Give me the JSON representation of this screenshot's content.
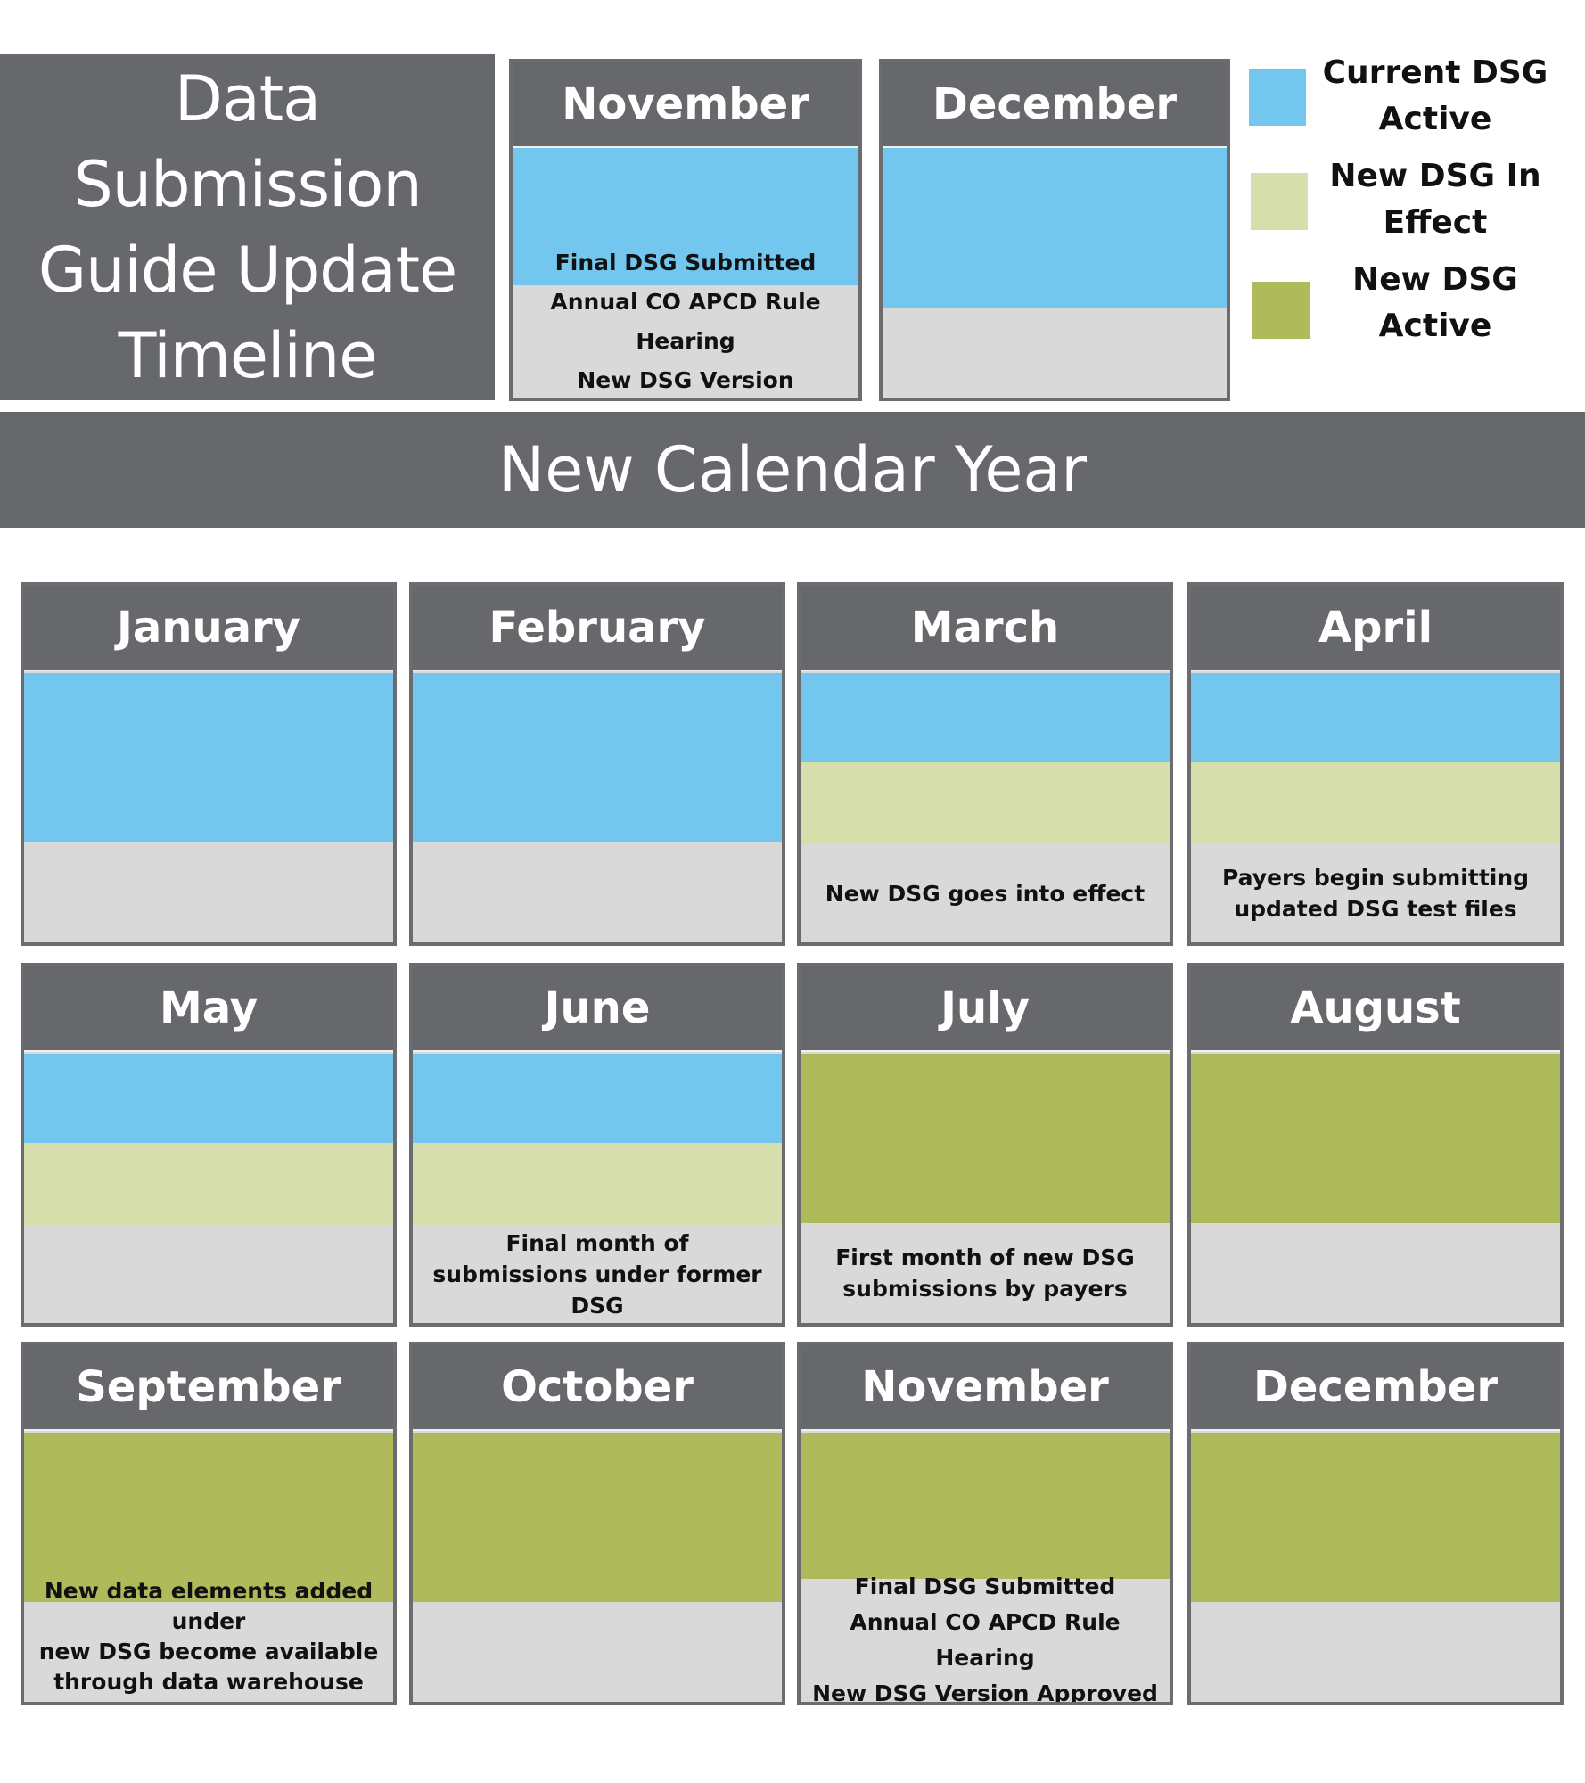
{
  "title": "Data Submission Guide Update Timeline",
  "title_lines": [
    "Data Submission",
    "Guide Update",
    "Timeline"
  ],
  "colors": {
    "header_gray": "#67686c",
    "empty_gray": "#d9d9d9",
    "current_dsg_active": "#73c7ef",
    "new_dsg_in_effect": "#d6dfab",
    "new_dsg_active": "#afbb5a"
  },
  "legend": [
    {
      "key": "current",
      "lines": [
        "Current DSG",
        "Active"
      ]
    },
    {
      "key": "effect",
      "lines": [
        "New DSG In",
        "Effect"
      ]
    },
    {
      "key": "new",
      "lines": [
        "New DSG",
        "Active"
      ]
    }
  ],
  "prior_year": [
    {
      "month": "November",
      "status": [
        "current"
      ],
      "notes": [
        "Final DSG Submitted",
        "Annual CO APCD Rule Hearing",
        "New DSG Version Approved"
      ]
    },
    {
      "month": "December",
      "status": [
        "current"
      ],
      "notes": []
    }
  ],
  "band_label": "New Calendar Year",
  "months": [
    {
      "month": "January",
      "status": [
        "current"
      ],
      "notes": []
    },
    {
      "month": "February",
      "status": [
        "current"
      ],
      "notes": []
    },
    {
      "month": "March",
      "status": [
        "current",
        "effect"
      ],
      "notes": [
        "New DSG goes into effect"
      ]
    },
    {
      "month": "April",
      "status": [
        "current",
        "effect"
      ],
      "notes": [
        "Payers begin submitting",
        "updated DSG test files"
      ]
    },
    {
      "month": "May",
      "status": [
        "current",
        "effect"
      ],
      "notes": []
    },
    {
      "month": "June",
      "status": [
        "current",
        "effect"
      ],
      "notes": [
        "Final month of",
        "submissions under former",
        "DSG"
      ]
    },
    {
      "month": "July",
      "status": [
        "new"
      ],
      "notes": [
        "First month of new DSG",
        "submissions by payers"
      ]
    },
    {
      "month": "August",
      "status": [
        "new"
      ],
      "notes": []
    },
    {
      "month": "September",
      "status": [
        "new"
      ],
      "notes": [
        "New data elements added under",
        "new DSG become available",
        "through  data warehouse refresh"
      ]
    },
    {
      "month": "October",
      "status": [
        "new"
      ],
      "notes": []
    },
    {
      "month": "November",
      "status": [
        "new"
      ],
      "notes": [
        "Final DSG Submitted",
        "Annual CO APCD Rule Hearing",
        "New DSG Version Approved"
      ]
    },
    {
      "month": "December",
      "status": [
        "new"
      ],
      "notes": []
    }
  ]
}
